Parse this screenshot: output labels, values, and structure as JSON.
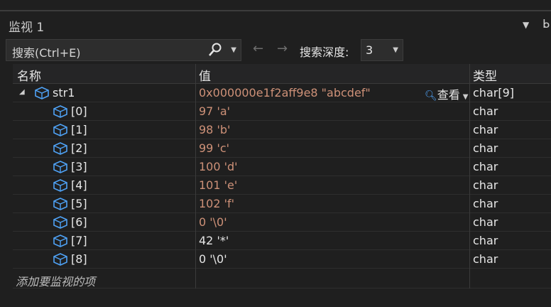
{
  "window": {
    "title": "监视 1",
    "menu_glyph": "▼",
    "pin_glyph": "ᖯ"
  },
  "toolbar": {
    "search_text": "搜索(Ctrl+E)",
    "search_icon": "search-icon",
    "back_glyph": "←",
    "forward_glyph": "→",
    "depth_label": "搜索深度:",
    "depth_value": "3"
  },
  "columns": {
    "name": "名称",
    "value": "值",
    "type": "类型"
  },
  "rows": [
    {
      "name": "str1",
      "value": "0x000000e1f2aff9e8 \"abcdef\"",
      "type": "char[9]",
      "expanded": true,
      "view_label": "查看"
    },
    {
      "name": "[0]",
      "value": "97 'a'",
      "type": "char"
    },
    {
      "name": "[1]",
      "value": "98 'b'",
      "type": "char"
    },
    {
      "name": "[2]",
      "value": "99 'c'",
      "type": "char"
    },
    {
      "name": "[3]",
      "value": "100 'd'",
      "type": "char"
    },
    {
      "name": "[4]",
      "value": "101 'e'",
      "type": "char"
    },
    {
      "name": "[5]",
      "value": "102 'f'",
      "type": "char"
    },
    {
      "name": "[6]",
      "value": "0 '\\0'",
      "type": "char"
    },
    {
      "name": "[7]",
      "value": "42 '*'",
      "type": "char"
    },
    {
      "name": "[8]",
      "value": "0 '\\0'",
      "type": "char"
    }
  ],
  "add_watch_placeholder": "添加要监视的项",
  "colors": {
    "value_changed": "#ce9178",
    "value_normal": "#e6e6e6",
    "background": "#1f1f1f",
    "icon_blue": "#4fa3f7"
  }
}
